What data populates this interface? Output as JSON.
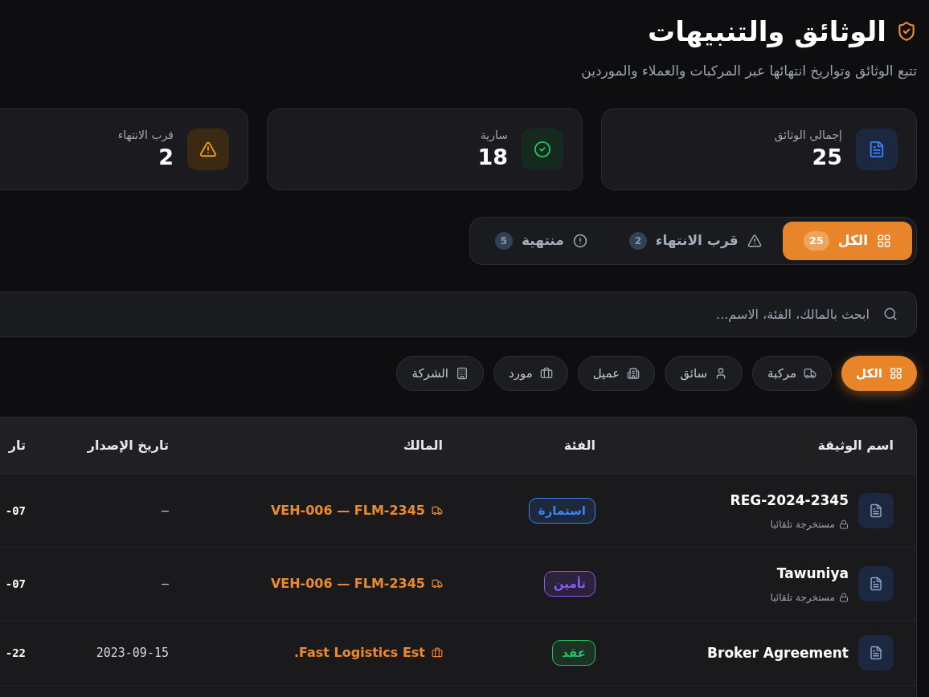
{
  "header": {
    "title": "الوثائق والتنبيهات",
    "subtitle": "تتبع الوثائق وتواريخ انتهائها عبر المركبات والعملاء والموردين"
  },
  "stat_cards": [
    {
      "kind": "total",
      "label": "إجمالي الوثائق",
      "value": "25"
    },
    {
      "kind": "valid",
      "label": "سارية",
      "value": "18"
    },
    {
      "kind": "expiring",
      "label": "قرب الانتهاء",
      "value": "2"
    }
  ],
  "status_tabs": [
    {
      "kind": "all",
      "label": "الكل",
      "count": "25",
      "selected": true
    },
    {
      "kind": "expiring",
      "label": "قرب الانتهاء",
      "count": "2",
      "selected": false
    },
    {
      "kind": "expired",
      "label": "منتهية",
      "count": "5",
      "selected": false
    }
  ],
  "search": {
    "placeholder": "ابحث بالمالك، الفئة، الاسم..."
  },
  "category_filters": [
    {
      "kind": "all",
      "label": "الكل",
      "selected": true
    },
    {
      "kind": "vehicle",
      "label": "مركبة",
      "selected": false
    },
    {
      "kind": "driver",
      "label": "سائق",
      "selected": false
    },
    {
      "kind": "customer",
      "label": "عميل",
      "selected": false
    },
    {
      "kind": "supplier",
      "label": "مورد",
      "selected": false
    },
    {
      "kind": "company",
      "label": "الشركة",
      "selected": false
    }
  ],
  "table": {
    "columns": [
      "اسم الوثيقة",
      "الفئة",
      "المالك",
      "تاريخ الإصدار",
      "تار"
    ],
    "rows": [
      {
        "name": "REG-2024-2345",
        "note": "مستخرجة تلقائيا",
        "category": {
          "label": "استمارة",
          "color": "#3b82f6"
        },
        "owner": {
          "kind": "vehicle",
          "label": "VEH-006 — FLM-2345"
        },
        "issue_date": "—",
        "column_5": "-07"
      },
      {
        "name": "Tawuniya",
        "note": "مستخرجة تلقائيا",
        "category": {
          "label": "تأمين",
          "color": "#8b5cf6"
        },
        "owner": {
          "kind": "vehicle",
          "label": "VEH-006 — FLM-2345"
        },
        "issue_date": "—",
        "column_5": "-07"
      },
      {
        "name": "Broker Agreement",
        "category": {
          "label": "عقد",
          "color": "#22c55e"
        },
        "owner": {
          "kind": "supplier",
          "label": "Fast Logistics Est."
        },
        "issue_date": "2023-09-15",
        "column_5": "-22"
      }
    ]
  }
}
